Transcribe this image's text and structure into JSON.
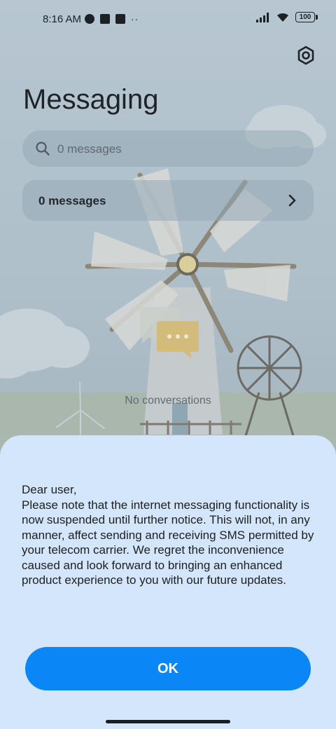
{
  "status": {
    "time": "8:16 AM",
    "battery": "100",
    "icons": [
      "notification-icon",
      "app-icon",
      "upload-icon",
      "more-icon",
      "signal-icon",
      "wifi-icon",
      "battery-icon"
    ]
  },
  "header": {
    "title": "Messaging",
    "settings_icon": "gear-icon"
  },
  "search": {
    "placeholder": "0 messages"
  },
  "summary": {
    "label": "0 messages"
  },
  "empty": {
    "text": "No conversations"
  },
  "dialog": {
    "message": "Dear user,\nPlease note that the internet messaging functionality is now suspended until further notice. This will not, in any manner, affect sending and receiving SMS permitted by your telecom carrier. We regret the inconvenience caused and look forward to bringing an enhanced product experience to you with our future updates.",
    "ok_label": "OK"
  },
  "colors": {
    "accent": "#0a87f5",
    "sheet": "#d4e6fb"
  }
}
